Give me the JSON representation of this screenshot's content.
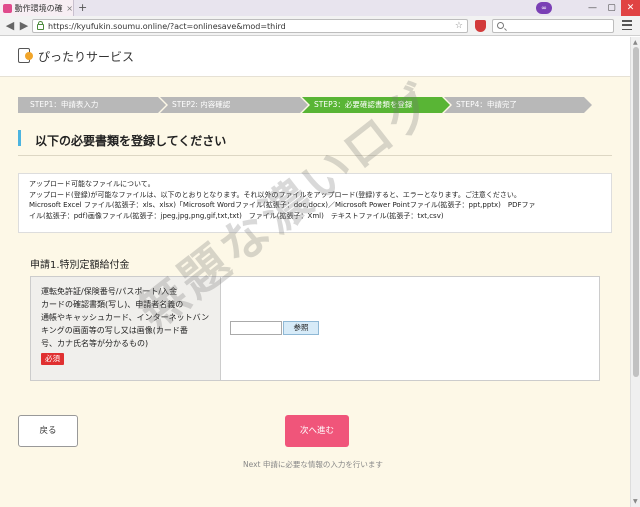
{
  "browser": {
    "tab_title": "動作環境の確",
    "tab_close": "×",
    "newtab": "+",
    "url": "https://kyufukin.soumu.online/?act=onlinesave&mod=third",
    "back": "◀",
    "forward": "▶",
    "bookmark": "☆",
    "mask": "∞",
    "win_min": "—",
    "win_max": "▢",
    "win_close": "✕"
  },
  "site": {
    "title": "ぴったりサービス"
  },
  "steps": [
    {
      "label": "STEP1：申請表入力"
    },
    {
      "label": "STEP2: 内容確認"
    },
    {
      "label": "STEP3：必要確認書類を登録"
    },
    {
      "label": "STEP4：申請完了"
    }
  ],
  "section": {
    "title": "以下の必要書類を登録してください"
  },
  "notice": {
    "lines": [
      "アップロード可能なファイルについて。",
      "アップロード(登録)が可能なファイルは、以下のとおりとなります。それ以外のファイルをアップロード(登録)すると、エラーとなります。ご注意ください。",
      "Microsoft Excel ファイル(拡張子：xls、xlsx)「Microsoft Wordファイル(拡張子：doc,docx)／Microsoft Power Pointファイル(拡張子：ppt,pptx)　PDFファ",
      "イル(拡張子：pdf)画像ファイル(拡張子：jpeg,jpg,png,gif,txt,txt)　ファイル(拡張子：Xml)　テキストファイル(拡張子：txt,csv)"
    ]
  },
  "application": {
    "heading": "申請1.特別定額給付金",
    "field_label_lines": [
      "運転免許証/保険番号/パスポート/入金",
      "カードの確認書類(写し)、申請者名義の",
      "通帳やキャッシュカード、インターネットバン",
      "キングの画面等の写し又は画像(カード番",
      "号、カナ氏名等が分かるもの)"
    ],
    "required": "必須",
    "browse": "参照"
  },
  "actions": {
    "back": "戻る",
    "next": "次へ進む",
    "next_note": "Next 申請に必要な情報の入力を行います"
  },
  "watermark": "無題な濃いログ",
  "colors": {
    "step_active": "#59b535",
    "step_inactive": "#b8b8b8",
    "accent_bar": "#4cb4e0",
    "required": "#e03030",
    "next_button": "#f0557a",
    "page_bg": "#fdf8e7"
  }
}
